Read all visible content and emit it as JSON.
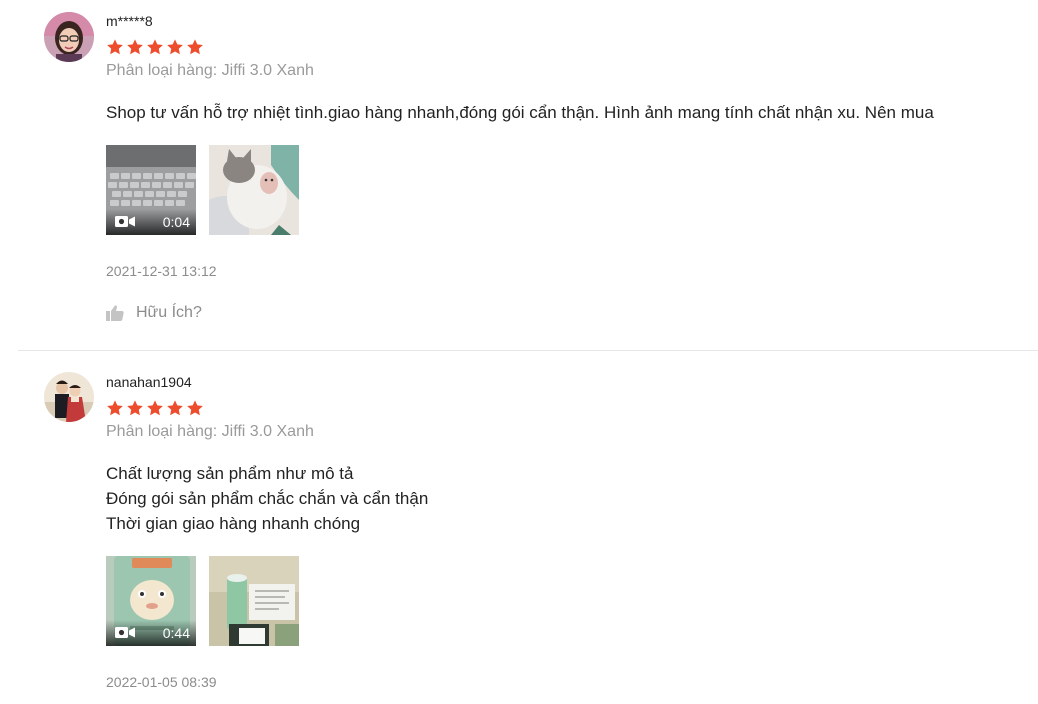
{
  "reviews": [
    {
      "username": "m*****8",
      "rating": 5,
      "variation": "Phân loại hàng: Jiffi 3.0 Xanh",
      "content_lines": [
        "Shop tư vấn hỗ trợ nhiệt tình.giao hàng nhanh,đóng gói cẩn thận. Hình ảnh mang tính chất nhận xu. Nên mua"
      ],
      "media": [
        {
          "type": "video",
          "duration": "0:04",
          "icon": "video-camera-icon"
        },
        {
          "type": "image",
          "icon": "photo"
        }
      ],
      "timestamp": "2021-12-31 13:12",
      "helpful_label": "Hữu Ích?"
    },
    {
      "username": "nanahan1904",
      "rating": 5,
      "variation": "Phân loại hàng: Jiffi 3.0 Xanh",
      "content_lines": [
        "Chất lượng sản phẩm như mô tả",
        "Đóng gói sản phẩm chắc chắn và cẩn thận",
        "Thời gian giao hàng nhanh chóng"
      ],
      "media": [
        {
          "type": "video",
          "duration": "0:44",
          "icon": "video-camera-icon"
        },
        {
          "type": "image",
          "icon": "photo"
        }
      ],
      "timestamp": "2022-01-05 08:39"
    }
  ],
  "colors": {
    "star": "#ee4d2d",
    "muted": "#8c8c8c",
    "divider": "#e6e6e6"
  }
}
